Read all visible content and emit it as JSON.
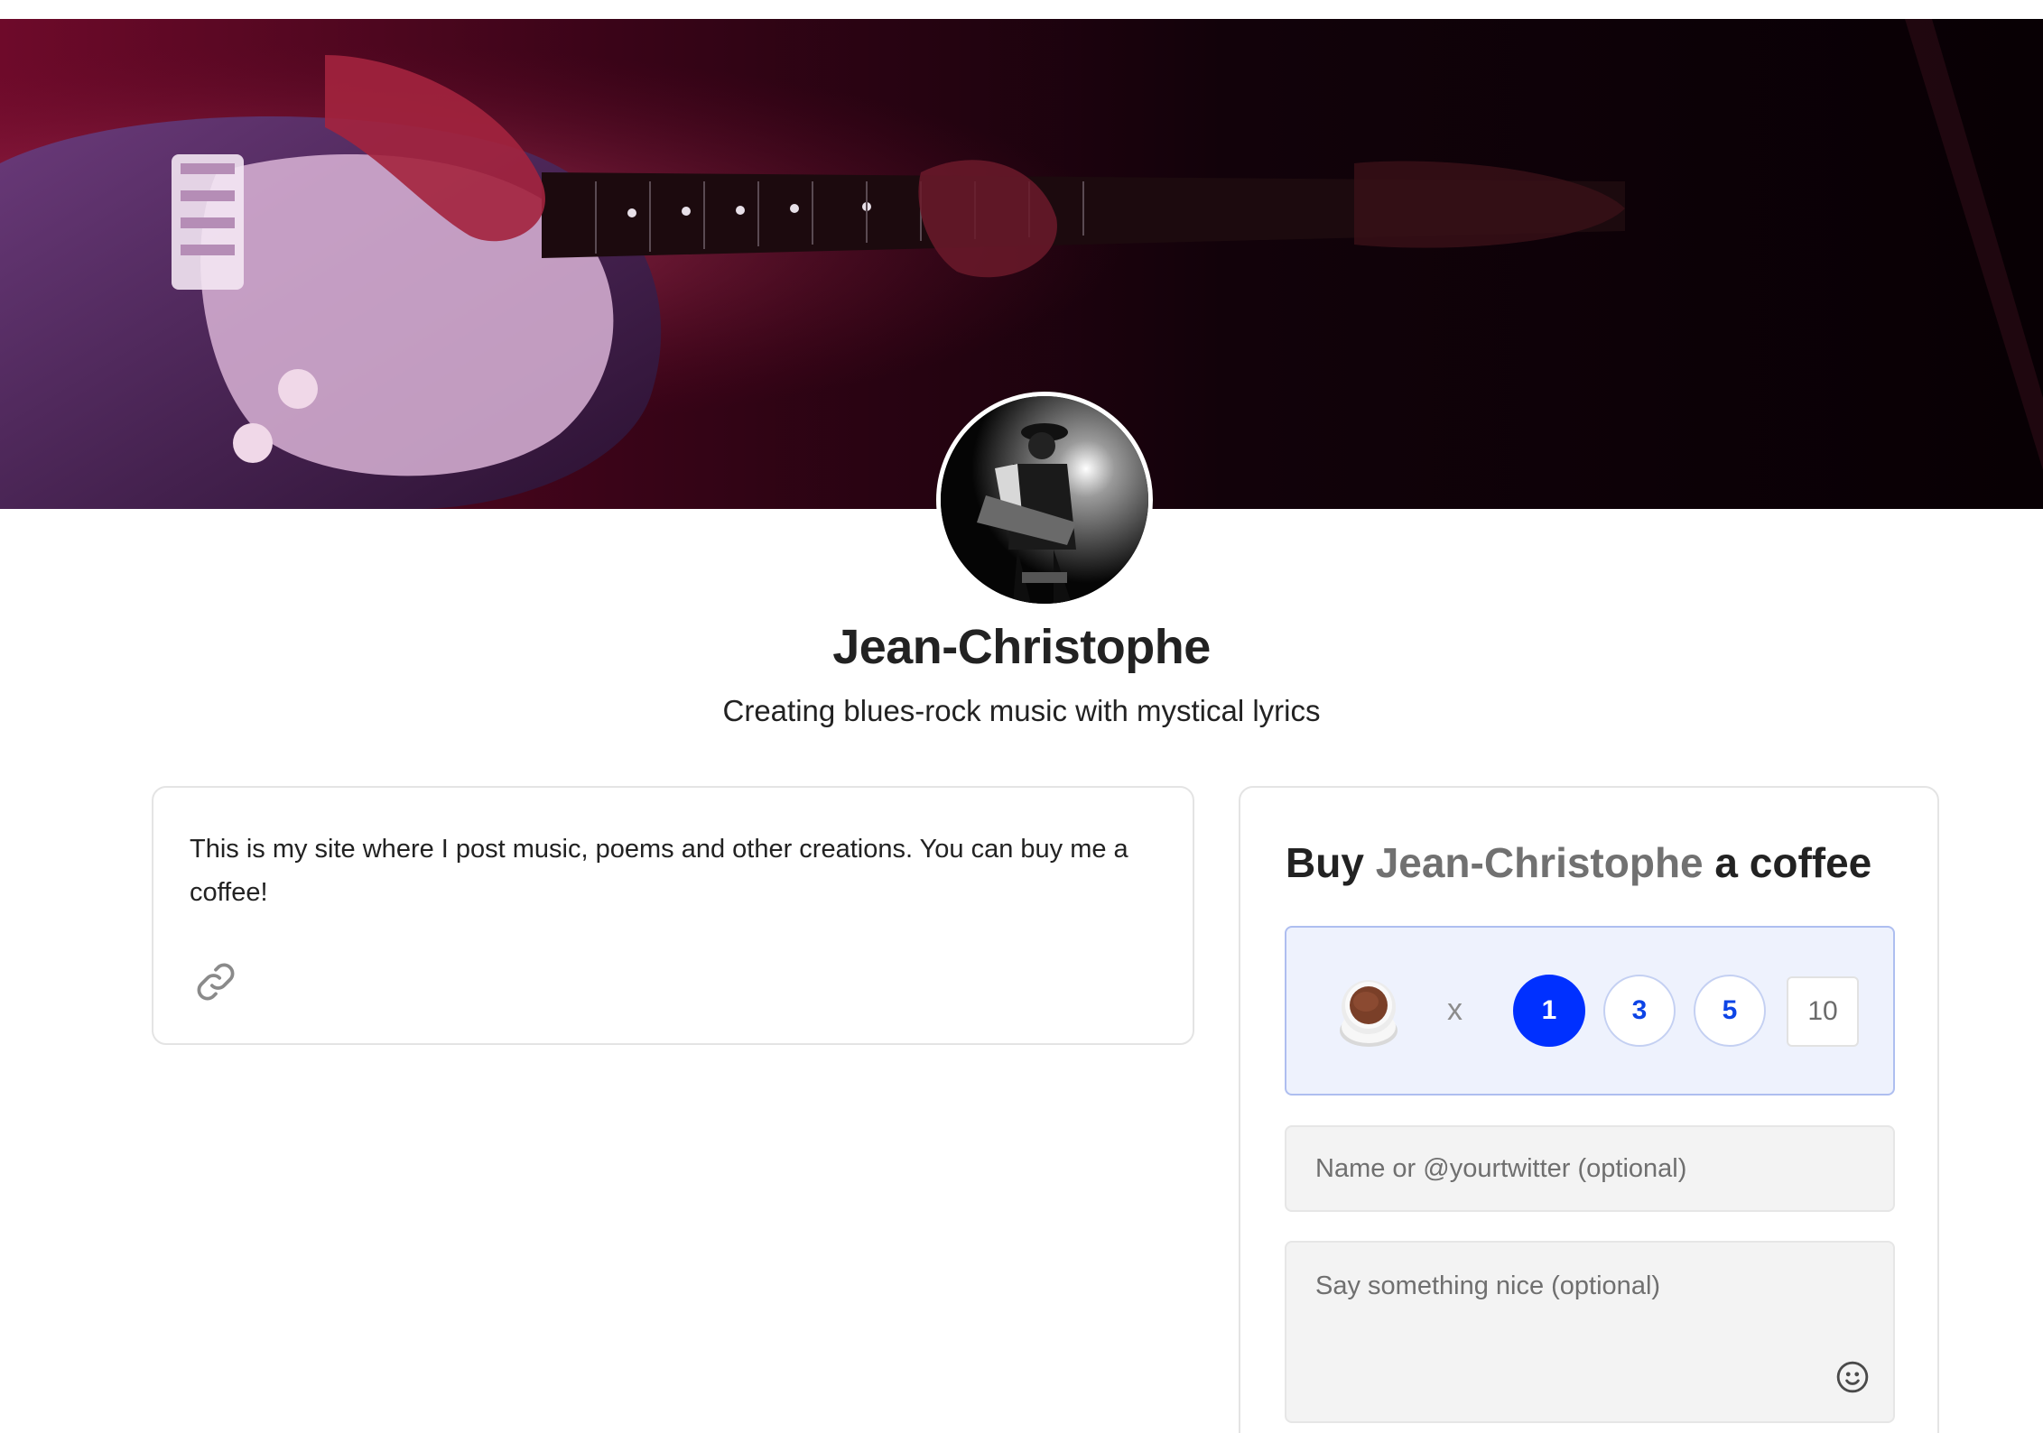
{
  "creator": {
    "name": "Jean-Christophe",
    "tagline": "Creating blues-rock music with mystical lyrics"
  },
  "about": {
    "text": "This is my site where I post music, poems and other creations. You can buy me a coffee!"
  },
  "support": {
    "title_prefix": "Buy ",
    "title_name": "Jean-Christophe",
    "title_suffix": " a coffee",
    "multiplier": "x",
    "quantities": [
      "1",
      "3",
      "5"
    ],
    "selected_quantity": "1",
    "custom_quantity": "10",
    "name_placeholder": "Name or @yourtwitter (optional)",
    "message_placeholder": "Say something nice (optional)"
  },
  "colors": {
    "accent": "#0030ff",
    "qty_box_bg": "#eef2fd",
    "muted_name": "#717171"
  },
  "icons": {
    "link": "link-icon",
    "emoji": "smiley-icon",
    "coffee": "coffee-cup-icon"
  }
}
